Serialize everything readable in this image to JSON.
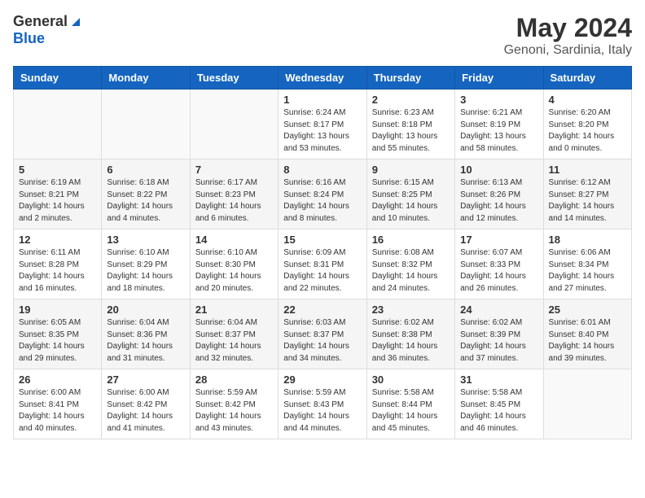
{
  "header": {
    "logo_general": "General",
    "logo_blue": "Blue",
    "month_title": "May 2024",
    "location": "Genoni, Sardinia, Italy"
  },
  "weekdays": [
    "Sunday",
    "Monday",
    "Tuesday",
    "Wednesday",
    "Thursday",
    "Friday",
    "Saturday"
  ],
  "weeks": [
    [
      {
        "day": "",
        "info": ""
      },
      {
        "day": "",
        "info": ""
      },
      {
        "day": "",
        "info": ""
      },
      {
        "day": "1",
        "info": "Sunrise: 6:24 AM\nSunset: 8:17 PM\nDaylight: 13 hours\nand 53 minutes."
      },
      {
        "day": "2",
        "info": "Sunrise: 6:23 AM\nSunset: 8:18 PM\nDaylight: 13 hours\nand 55 minutes."
      },
      {
        "day": "3",
        "info": "Sunrise: 6:21 AM\nSunset: 8:19 PM\nDaylight: 13 hours\nand 58 minutes."
      },
      {
        "day": "4",
        "info": "Sunrise: 6:20 AM\nSunset: 8:20 PM\nDaylight: 14 hours\nand 0 minutes."
      }
    ],
    [
      {
        "day": "5",
        "info": "Sunrise: 6:19 AM\nSunset: 8:21 PM\nDaylight: 14 hours\nand 2 minutes."
      },
      {
        "day": "6",
        "info": "Sunrise: 6:18 AM\nSunset: 8:22 PM\nDaylight: 14 hours\nand 4 minutes."
      },
      {
        "day": "7",
        "info": "Sunrise: 6:17 AM\nSunset: 8:23 PM\nDaylight: 14 hours\nand 6 minutes."
      },
      {
        "day": "8",
        "info": "Sunrise: 6:16 AM\nSunset: 8:24 PM\nDaylight: 14 hours\nand 8 minutes."
      },
      {
        "day": "9",
        "info": "Sunrise: 6:15 AM\nSunset: 8:25 PM\nDaylight: 14 hours\nand 10 minutes."
      },
      {
        "day": "10",
        "info": "Sunrise: 6:13 AM\nSunset: 8:26 PM\nDaylight: 14 hours\nand 12 minutes."
      },
      {
        "day": "11",
        "info": "Sunrise: 6:12 AM\nSunset: 8:27 PM\nDaylight: 14 hours\nand 14 minutes."
      }
    ],
    [
      {
        "day": "12",
        "info": "Sunrise: 6:11 AM\nSunset: 8:28 PM\nDaylight: 14 hours\nand 16 minutes."
      },
      {
        "day": "13",
        "info": "Sunrise: 6:10 AM\nSunset: 8:29 PM\nDaylight: 14 hours\nand 18 minutes."
      },
      {
        "day": "14",
        "info": "Sunrise: 6:10 AM\nSunset: 8:30 PM\nDaylight: 14 hours\nand 20 minutes."
      },
      {
        "day": "15",
        "info": "Sunrise: 6:09 AM\nSunset: 8:31 PM\nDaylight: 14 hours\nand 22 minutes."
      },
      {
        "day": "16",
        "info": "Sunrise: 6:08 AM\nSunset: 8:32 PM\nDaylight: 14 hours\nand 24 minutes."
      },
      {
        "day": "17",
        "info": "Sunrise: 6:07 AM\nSunset: 8:33 PM\nDaylight: 14 hours\nand 26 minutes."
      },
      {
        "day": "18",
        "info": "Sunrise: 6:06 AM\nSunset: 8:34 PM\nDaylight: 14 hours\nand 27 minutes."
      }
    ],
    [
      {
        "day": "19",
        "info": "Sunrise: 6:05 AM\nSunset: 8:35 PM\nDaylight: 14 hours\nand 29 minutes."
      },
      {
        "day": "20",
        "info": "Sunrise: 6:04 AM\nSunset: 8:36 PM\nDaylight: 14 hours\nand 31 minutes."
      },
      {
        "day": "21",
        "info": "Sunrise: 6:04 AM\nSunset: 8:37 PM\nDaylight: 14 hours\nand 32 minutes."
      },
      {
        "day": "22",
        "info": "Sunrise: 6:03 AM\nSunset: 8:37 PM\nDaylight: 14 hours\nand 34 minutes."
      },
      {
        "day": "23",
        "info": "Sunrise: 6:02 AM\nSunset: 8:38 PM\nDaylight: 14 hours\nand 36 minutes."
      },
      {
        "day": "24",
        "info": "Sunrise: 6:02 AM\nSunset: 8:39 PM\nDaylight: 14 hours\nand 37 minutes."
      },
      {
        "day": "25",
        "info": "Sunrise: 6:01 AM\nSunset: 8:40 PM\nDaylight: 14 hours\nand 39 minutes."
      }
    ],
    [
      {
        "day": "26",
        "info": "Sunrise: 6:00 AM\nSunset: 8:41 PM\nDaylight: 14 hours\nand 40 minutes."
      },
      {
        "day": "27",
        "info": "Sunrise: 6:00 AM\nSunset: 8:42 PM\nDaylight: 14 hours\nand 41 minutes."
      },
      {
        "day": "28",
        "info": "Sunrise: 5:59 AM\nSunset: 8:42 PM\nDaylight: 14 hours\nand 43 minutes."
      },
      {
        "day": "29",
        "info": "Sunrise: 5:59 AM\nSunset: 8:43 PM\nDaylight: 14 hours\nand 44 minutes."
      },
      {
        "day": "30",
        "info": "Sunrise: 5:58 AM\nSunset: 8:44 PM\nDaylight: 14 hours\nand 45 minutes."
      },
      {
        "day": "31",
        "info": "Sunrise: 5:58 AM\nSunset: 8:45 PM\nDaylight: 14 hours\nand 46 minutes."
      },
      {
        "day": "",
        "info": ""
      }
    ]
  ]
}
